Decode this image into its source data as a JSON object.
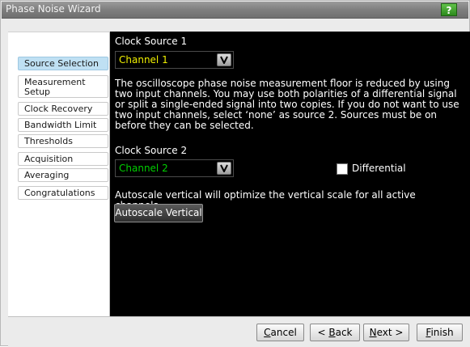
{
  "window": {
    "title": "Phase Noise Wizard",
    "help_label": "?"
  },
  "nav": {
    "items": [
      {
        "label": "Source Selection",
        "active": true
      },
      {
        "label": "Measurement Setup",
        "active": false
      },
      {
        "label": "Clock Recovery",
        "active": false
      },
      {
        "label": "Bandwidth Limit",
        "active": false
      },
      {
        "label": "Thresholds",
        "active": false
      },
      {
        "label": "Acquisition",
        "active": false
      },
      {
        "label": "Averaging",
        "active": false
      },
      {
        "label": "Congratulations",
        "active": false
      }
    ]
  },
  "main": {
    "source1": {
      "label": "Clock Source 1",
      "value": "Channel 1",
      "color": "#f0f000"
    },
    "description": "The oscilloscope phase noise measurement floor is reduced by using two input channels. You may use both polarities of a differential signal or split a single-ended signal into two copies. If you do not want to use two input channels, select ‘none’ as source 2. Sources must be on before they can be selected.",
    "source2": {
      "label": "Clock Source 2",
      "value": "Channel 2",
      "color": "#00d000"
    },
    "differential": {
      "label": "Differential",
      "checked": false
    },
    "autoscale_text": "Autoscale vertical will optimize the vertical scale for all active channels.",
    "autoscale_button": "Autoscale Vertical"
  },
  "footer": {
    "cancel_first": "C",
    "cancel_rest": "ancel",
    "back_prefix": "< ",
    "back_first": "B",
    "back_rest": "ack",
    "next_first": "N",
    "next_rest": "ext >",
    "finish_first": "F",
    "finish_rest": "inish"
  }
}
